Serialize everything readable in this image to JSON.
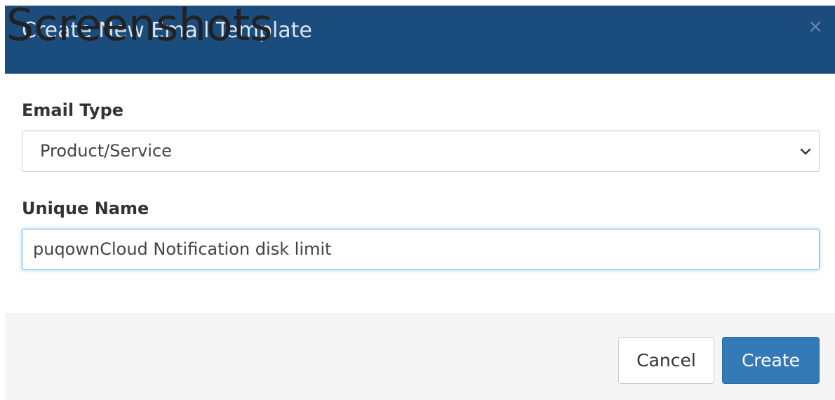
{
  "watermark": "Screenshots",
  "modal": {
    "title": "Create New Email Template",
    "close_icon": "×"
  },
  "form": {
    "email_type": {
      "label": "Email Type",
      "selected": "Product/Service"
    },
    "unique_name": {
      "label": "Unique Name",
      "value": "puqownCloud Notification disk limit"
    }
  },
  "footer": {
    "cancel_label": "Cancel",
    "create_label": "Create"
  },
  "colors": {
    "header_bg": "#1b4c7e",
    "primary_button": "#337ab7"
  }
}
